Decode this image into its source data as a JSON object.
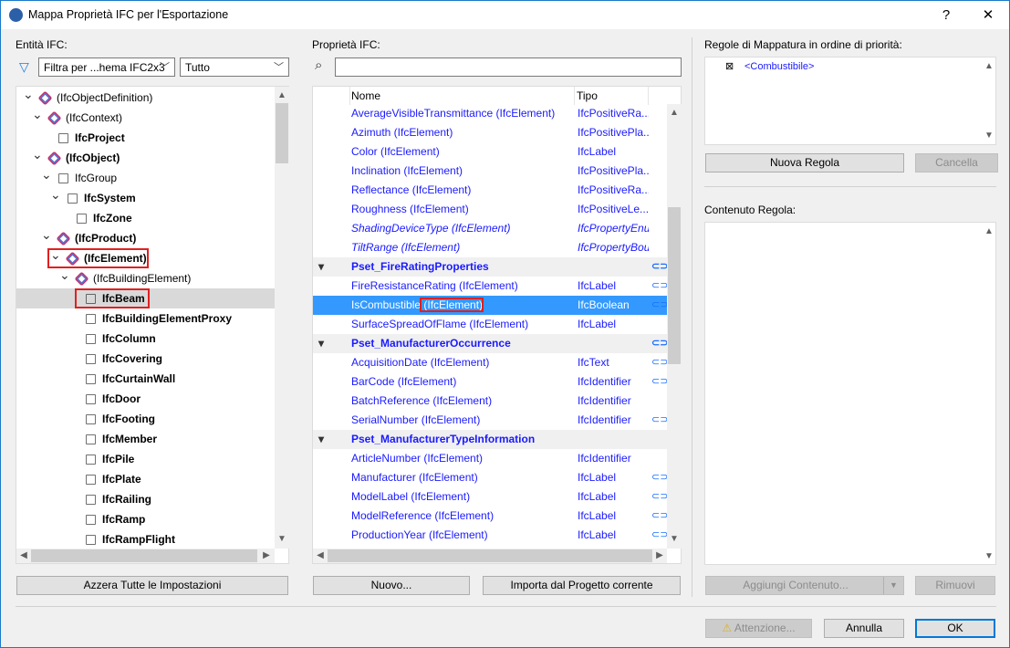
{
  "window": {
    "title": "Mappa Proprietà IFC per l'Esportazione",
    "help": "?",
    "close": "✕"
  },
  "left": {
    "label": "Entità IFC:",
    "filter_icon": "funnel-icon",
    "filter_combo": "Filtra per ...hema IFC2x3",
    "type_combo": "Tutto",
    "tree": [
      {
        "label": "(IfcObjectDefinition)",
        "level": 0,
        "expanded": true,
        "bold": false
      },
      {
        "label": "(IfcContext)",
        "level": 1,
        "expanded": true,
        "bold": false
      },
      {
        "label": "IfcProject",
        "level": 2,
        "bold": true
      },
      {
        "label": "(IfcObject)",
        "level": 1,
        "expanded": true,
        "bold": true
      },
      {
        "label": "IfcGroup",
        "level": 2,
        "expanded": true,
        "bold": false
      },
      {
        "label": "IfcSystem",
        "level": 3,
        "expanded": true,
        "bold": true
      },
      {
        "label": "IfcZone",
        "level": 4,
        "bold": true
      },
      {
        "label": "(IfcProduct)",
        "level": 2,
        "expanded": true,
        "bold": true
      },
      {
        "label": "(IfcElement)",
        "level": 3,
        "expanded": true,
        "bold": true,
        "highlight": true
      },
      {
        "label": "(IfcBuildingElement)",
        "level": 4,
        "expanded": true,
        "bold": false
      },
      {
        "label": "IfcBeam",
        "level": 5,
        "bold": true,
        "selected": true,
        "highlight": true
      },
      {
        "label": "IfcBuildingElementProxy",
        "level": 5,
        "bold": true
      },
      {
        "label": "IfcColumn",
        "level": 5,
        "bold": true
      },
      {
        "label": "IfcCovering",
        "level": 5,
        "bold": true
      },
      {
        "label": "IfcCurtainWall",
        "level": 5,
        "bold": true
      },
      {
        "label": "IfcDoor",
        "level": 5,
        "bold": true
      },
      {
        "label": "IfcFooting",
        "level": 5,
        "bold": true
      },
      {
        "label": "IfcMember",
        "level": 5,
        "bold": true
      },
      {
        "label": "IfcPile",
        "level": 5,
        "bold": true
      },
      {
        "label": "IfcPlate",
        "level": 5,
        "bold": true
      },
      {
        "label": "IfcRailing",
        "level": 5,
        "bold": true
      },
      {
        "label": "IfcRamp",
        "level": 5,
        "bold": true
      },
      {
        "label": "IfcRampFlight",
        "level": 5,
        "bold": true
      }
    ],
    "reset_button": "Azzera Tutte le Impostazioni"
  },
  "middle": {
    "label": "Proprietà IFC:",
    "search_value": "",
    "columns": [
      "Nome",
      "Tipo"
    ],
    "rows": [
      {
        "name": "AverageVisibleTransmittance (IfcElement)",
        "type": "IfcPositiveRa..."
      },
      {
        "name": "Azimuth (IfcElement)",
        "type": "IfcPositivePla..."
      },
      {
        "name": "Color (IfcElement)",
        "type": "IfcLabel"
      },
      {
        "name": "Inclination (IfcElement)",
        "type": "IfcPositivePla..."
      },
      {
        "name": "Reflectance (IfcElement)",
        "type": "IfcPositiveRa..."
      },
      {
        "name": "Roughness (IfcElement)",
        "type": "IfcPositiveLe..."
      },
      {
        "name": "ShadingDeviceType (IfcElement)",
        "type": "IfcPropertyEnu...",
        "italic": true
      },
      {
        "name": "TiltRange (IfcElement)",
        "type": "IfcPropertyBou...",
        "italic": true
      },
      {
        "name": "Pset_FireRatingProperties",
        "group": true,
        "link": true
      },
      {
        "name": "FireResistanceRating (IfcElement)",
        "type": "IfcLabel",
        "link": true
      },
      {
        "name": "IsCombustible",
        "suffix": " (IfcElement)",
        "type": "IfcBoolean",
        "link": true,
        "selected": true
      },
      {
        "name": "SurfaceSpreadOfFlame (IfcElement)",
        "type": "IfcLabel"
      },
      {
        "name": "Pset_ManufacturerOccurrence",
        "group": true,
        "link": true
      },
      {
        "name": "AcquisitionDate (IfcElement)",
        "type": "IfcText",
        "link": true
      },
      {
        "name": "BarCode (IfcElement)",
        "type": "IfcIdentifier",
        "link": true
      },
      {
        "name": "BatchReference (IfcElement)",
        "type": "IfcIdentifier"
      },
      {
        "name": "SerialNumber (IfcElement)",
        "type": "IfcIdentifier",
        "link": true
      },
      {
        "name": "Pset_ManufacturerTypeInformation",
        "group": true
      },
      {
        "name": "ArticleNumber (IfcElement)",
        "type": "IfcIdentifier"
      },
      {
        "name": "Manufacturer (IfcElement)",
        "type": "IfcLabel",
        "link": true
      },
      {
        "name": "ModelLabel (IfcElement)",
        "type": "IfcLabel",
        "link": true
      },
      {
        "name": "ModelReference (IfcElement)",
        "type": "IfcLabel",
        "link": true
      },
      {
        "name": "ProductionYear (IfcElement)",
        "type": "IfcLabel",
        "link": true
      }
    ],
    "new_button": "Nuovo...",
    "import_button": "Importa dal Progetto corrente"
  },
  "right": {
    "rules_label": "Regole di Mappatura in ordine di priorità:",
    "rules": [
      {
        "label": "<Combustibile>",
        "checked": true
      }
    ],
    "new_rule_button": "Nuova Regola",
    "delete_button": "Cancella",
    "content_label": "Contenuto Regola:",
    "add_content_button": "Aggiungi Contenuto...",
    "remove_button": "Rimuovi"
  },
  "footer": {
    "warning_button": "Attenzione...",
    "cancel_button": "Annulla",
    "ok_button": "OK"
  },
  "colors": {
    "accent": "#0078d7",
    "link_text": "#1a1aff",
    "selection": "#3399ff",
    "highlight_box": "#e02020"
  }
}
